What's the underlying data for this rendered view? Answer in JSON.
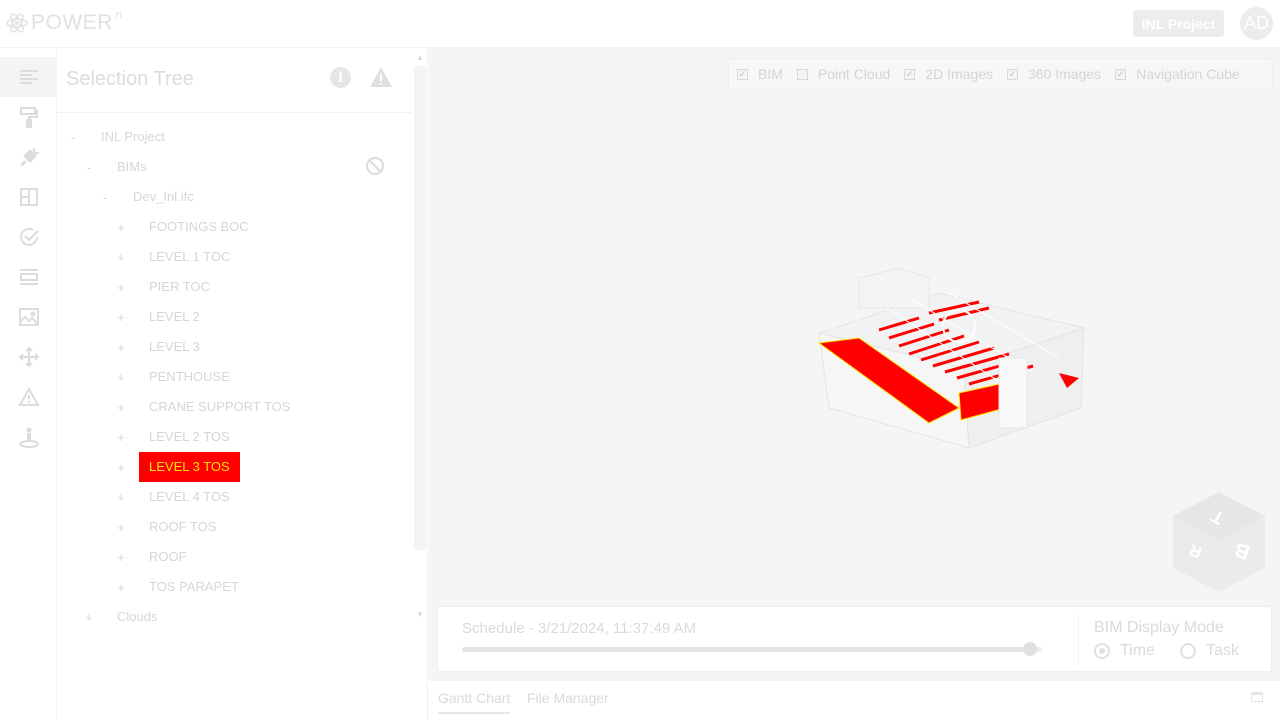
{
  "header": {
    "logo_text": "POWER",
    "logo_sup": "n",
    "project_button": "INL Project",
    "avatar_initials": "AD"
  },
  "rail": {
    "items": [
      {
        "icon": "list-icon",
        "active": true
      },
      {
        "icon": "paint-roller-icon",
        "active": false
      },
      {
        "icon": "plug-icon",
        "active": false
      },
      {
        "icon": "layout-icon",
        "active": false
      },
      {
        "icon": "check-circle-icon",
        "active": false
      },
      {
        "icon": "section-icon",
        "active": false
      },
      {
        "icon": "image-icon",
        "active": false
      },
      {
        "icon": "move-icon",
        "active": false
      },
      {
        "icon": "warning-icon",
        "active": false
      },
      {
        "icon": "person-location-icon",
        "active": false
      }
    ]
  },
  "tree": {
    "title": "Selection Tree",
    "info_icon_glyph": "i",
    "nodes": [
      {
        "toggle": "-",
        "label": "INL Project",
        "level": 0
      },
      {
        "toggle": "-",
        "label": "BIMs",
        "level": 1
      },
      {
        "toggle": "-",
        "label": "Dev_Inl.ifc",
        "level": 2
      },
      {
        "toggle": "+",
        "label": "FOOTINGS BOC",
        "level": 3
      },
      {
        "toggle": "+",
        "label": "LEVEL 1 TOC",
        "level": 3
      },
      {
        "toggle": "+",
        "label": "PIER TOC",
        "level": 3
      },
      {
        "toggle": "+",
        "label": "LEVEL 2",
        "level": 3
      },
      {
        "toggle": "+",
        "label": "LEVEL 3",
        "level": 3
      },
      {
        "toggle": "+",
        "label": "PENTHOUSE",
        "level": 3
      },
      {
        "toggle": "+",
        "label": "CRANE SUPPORT TOS",
        "level": 3
      },
      {
        "toggle": "+",
        "label": "LEVEL 2 TOS",
        "level": 3
      },
      {
        "toggle": "+",
        "label": "LEVEL 3 TOS",
        "level": 3,
        "selected": true
      },
      {
        "toggle": "+",
        "label": "LEVEL 4 TOS",
        "level": 3
      },
      {
        "toggle": "+",
        "label": "ROOF TOS",
        "level": 3
      },
      {
        "toggle": "+",
        "label": "ROOF",
        "level": 3
      },
      {
        "toggle": "+",
        "label": "TOS PARAPET",
        "level": 3
      },
      {
        "toggle": "+",
        "label": "Clouds",
        "level": 1
      }
    ]
  },
  "viewer": {
    "layers": [
      {
        "label": "BIM",
        "checked": true
      },
      {
        "label": "Point Cloud",
        "checked": false
      },
      {
        "label": "2D Images",
        "checked": true
      },
      {
        "label": "360 Images",
        "checked": true
      },
      {
        "label": "Navigation Cube",
        "checked": true
      }
    ],
    "highlight_color": "#ff0000",
    "selected_text_color": "#ffe300"
  },
  "schedule": {
    "title": "Schedule - 3/21/2024, 11:37:49 AM",
    "slider_position": 0.98,
    "mode_title": "BIM Display Mode",
    "modes": [
      {
        "label": "Time",
        "selected": true
      },
      {
        "label": "Task",
        "selected": false
      }
    ]
  },
  "bottom_tabs": [
    {
      "label": "Gantt Chart",
      "active": true
    },
    {
      "label": "File Manager",
      "active": false
    }
  ]
}
